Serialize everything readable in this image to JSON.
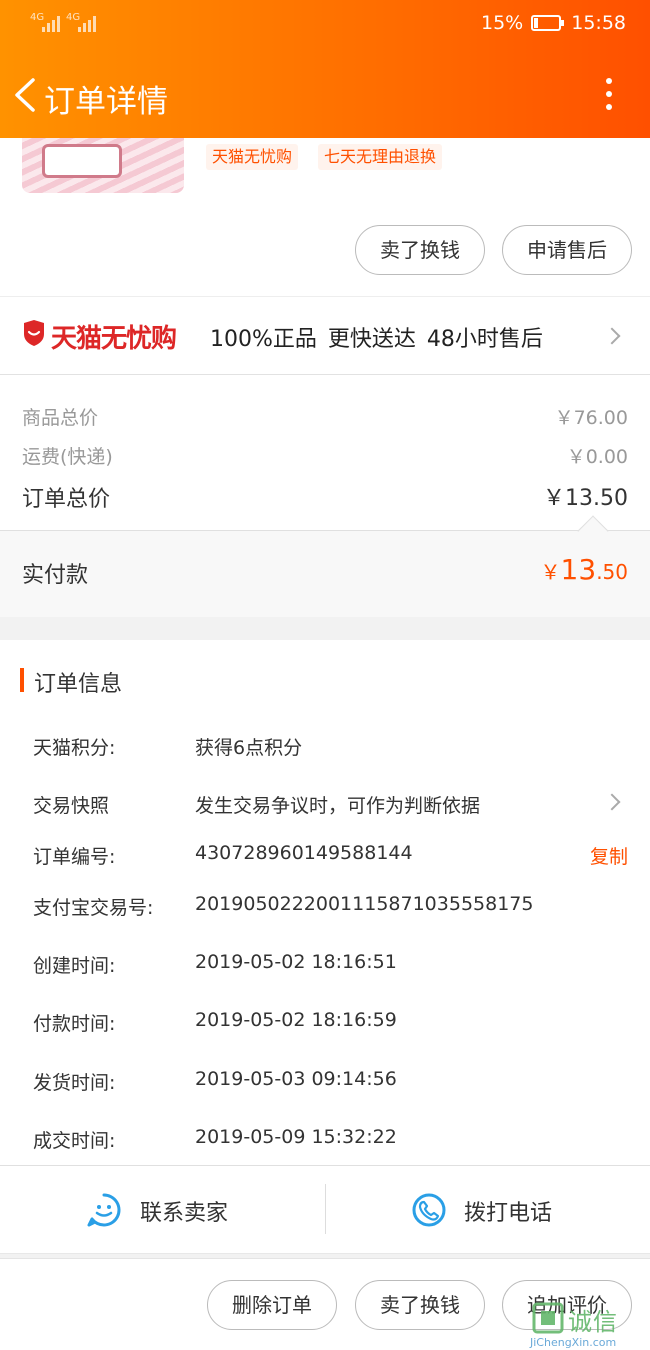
{
  "status_bar": {
    "signal1": "4G",
    "signal2": "4G",
    "battery_percent": "15%",
    "battery_level": 0.15,
    "time": "15:58"
  },
  "header": {
    "title": "订单详情",
    "back_icon": "chevron-left-icon",
    "more_icon": "more-vertical-icon"
  },
  "goods": {
    "tags": [
      "天猫无忧购",
      "七天无理由退换"
    ],
    "buttons": [
      "卖了换钱",
      "申请售后"
    ]
  },
  "guarantee": {
    "brand": "天猫无忧购",
    "text": "100%正品  更快送达  48小时售后"
  },
  "price": {
    "goods_total_label": "商品总价",
    "goods_total_value": "￥76.00",
    "shipping_label": "运费(快递)",
    "shipping_value": "￥0.00",
    "order_total_label": "订单总价",
    "order_total_value": "￥13.50"
  },
  "paid": {
    "label": "实付款",
    "currency": "￥",
    "integer": "13",
    "decimal": ".50"
  },
  "order_info": {
    "title": "订单信息",
    "rows": [
      {
        "label": "天猫积分:",
        "value": "获得6点积分"
      },
      {
        "label": "交易快照",
        "value": "发生交易争议时，可作为判断依据"
      },
      {
        "label": "订单编号:",
        "value": "430728960149588144"
      },
      {
        "label": "支付宝交易号:",
        "value": "2019050222001115871035558175"
      },
      {
        "label": "创建时间:",
        "value": "2019-05-02 18:16:51"
      },
      {
        "label": "付款时间:",
        "value": "2019-05-02 18:16:59"
      },
      {
        "label": "发货时间:",
        "value": "2019-05-03 09:14:56"
      },
      {
        "label": "成交时间:",
        "value": "2019-05-09 15:32:22"
      }
    ],
    "copy_label": "复制"
  },
  "contact": {
    "seller_label": "联系卖家",
    "phone_label": "拨打电话"
  },
  "bottom_actions": [
    "删除订单",
    "卖了换钱",
    "追加评价"
  ],
  "watermark": {
    "main": "诚信",
    "sub": "JiChengXin.com"
  },
  "colors": {
    "accent": "#ff5000",
    "header_start": "#ff9200",
    "header_end": "#ff5000",
    "tmall_red": "#dd2727",
    "icon_blue": "#2a9fe6"
  }
}
